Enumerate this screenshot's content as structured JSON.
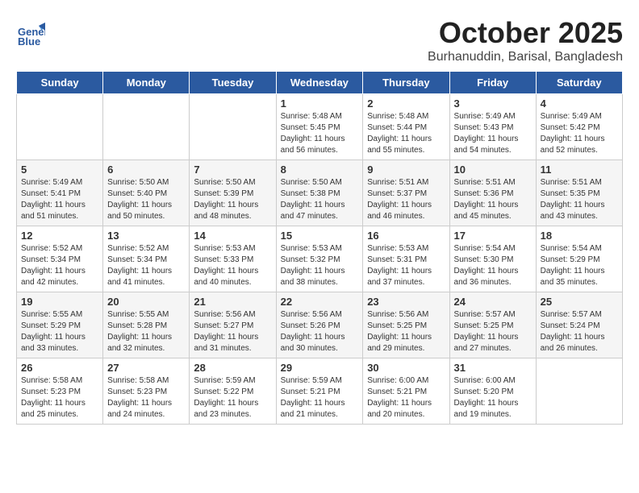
{
  "logo": {
    "name_line1": "General",
    "name_line2": "Blue"
  },
  "header": {
    "title": "October 2025",
    "subtitle": "Burhanuddin, Barisal, Bangladesh"
  },
  "weekdays": [
    "Sunday",
    "Monday",
    "Tuesday",
    "Wednesday",
    "Thursday",
    "Friday",
    "Saturday"
  ],
  "weeks": [
    [
      {
        "day": "",
        "sunrise": "",
        "sunset": "",
        "daylight": ""
      },
      {
        "day": "",
        "sunrise": "",
        "sunset": "",
        "daylight": ""
      },
      {
        "day": "",
        "sunrise": "",
        "sunset": "",
        "daylight": ""
      },
      {
        "day": "1",
        "sunrise": "Sunrise: 5:48 AM",
        "sunset": "Sunset: 5:45 PM",
        "daylight": "Daylight: 11 hours and 56 minutes."
      },
      {
        "day": "2",
        "sunrise": "Sunrise: 5:48 AM",
        "sunset": "Sunset: 5:44 PM",
        "daylight": "Daylight: 11 hours and 55 minutes."
      },
      {
        "day": "3",
        "sunrise": "Sunrise: 5:49 AM",
        "sunset": "Sunset: 5:43 PM",
        "daylight": "Daylight: 11 hours and 54 minutes."
      },
      {
        "day": "4",
        "sunrise": "Sunrise: 5:49 AM",
        "sunset": "Sunset: 5:42 PM",
        "daylight": "Daylight: 11 hours and 52 minutes."
      }
    ],
    [
      {
        "day": "5",
        "sunrise": "Sunrise: 5:49 AM",
        "sunset": "Sunset: 5:41 PM",
        "daylight": "Daylight: 11 hours and 51 minutes."
      },
      {
        "day": "6",
        "sunrise": "Sunrise: 5:50 AM",
        "sunset": "Sunset: 5:40 PM",
        "daylight": "Daylight: 11 hours and 50 minutes."
      },
      {
        "day": "7",
        "sunrise": "Sunrise: 5:50 AM",
        "sunset": "Sunset: 5:39 PM",
        "daylight": "Daylight: 11 hours and 48 minutes."
      },
      {
        "day": "8",
        "sunrise": "Sunrise: 5:50 AM",
        "sunset": "Sunset: 5:38 PM",
        "daylight": "Daylight: 11 hours and 47 minutes."
      },
      {
        "day": "9",
        "sunrise": "Sunrise: 5:51 AM",
        "sunset": "Sunset: 5:37 PM",
        "daylight": "Daylight: 11 hours and 46 minutes."
      },
      {
        "day": "10",
        "sunrise": "Sunrise: 5:51 AM",
        "sunset": "Sunset: 5:36 PM",
        "daylight": "Daylight: 11 hours and 45 minutes."
      },
      {
        "day": "11",
        "sunrise": "Sunrise: 5:51 AM",
        "sunset": "Sunset: 5:35 PM",
        "daylight": "Daylight: 11 hours and 43 minutes."
      }
    ],
    [
      {
        "day": "12",
        "sunrise": "Sunrise: 5:52 AM",
        "sunset": "Sunset: 5:34 PM",
        "daylight": "Daylight: 11 hours and 42 minutes."
      },
      {
        "day": "13",
        "sunrise": "Sunrise: 5:52 AM",
        "sunset": "Sunset: 5:34 PM",
        "daylight": "Daylight: 11 hours and 41 minutes."
      },
      {
        "day": "14",
        "sunrise": "Sunrise: 5:53 AM",
        "sunset": "Sunset: 5:33 PM",
        "daylight": "Daylight: 11 hours and 40 minutes."
      },
      {
        "day": "15",
        "sunrise": "Sunrise: 5:53 AM",
        "sunset": "Sunset: 5:32 PM",
        "daylight": "Daylight: 11 hours and 38 minutes."
      },
      {
        "day": "16",
        "sunrise": "Sunrise: 5:53 AM",
        "sunset": "Sunset: 5:31 PM",
        "daylight": "Daylight: 11 hours and 37 minutes."
      },
      {
        "day": "17",
        "sunrise": "Sunrise: 5:54 AM",
        "sunset": "Sunset: 5:30 PM",
        "daylight": "Daylight: 11 hours and 36 minutes."
      },
      {
        "day": "18",
        "sunrise": "Sunrise: 5:54 AM",
        "sunset": "Sunset: 5:29 PM",
        "daylight": "Daylight: 11 hours and 35 minutes."
      }
    ],
    [
      {
        "day": "19",
        "sunrise": "Sunrise: 5:55 AM",
        "sunset": "Sunset: 5:29 PM",
        "daylight": "Daylight: 11 hours and 33 minutes."
      },
      {
        "day": "20",
        "sunrise": "Sunrise: 5:55 AM",
        "sunset": "Sunset: 5:28 PM",
        "daylight": "Daylight: 11 hours and 32 minutes."
      },
      {
        "day": "21",
        "sunrise": "Sunrise: 5:56 AM",
        "sunset": "Sunset: 5:27 PM",
        "daylight": "Daylight: 11 hours and 31 minutes."
      },
      {
        "day": "22",
        "sunrise": "Sunrise: 5:56 AM",
        "sunset": "Sunset: 5:26 PM",
        "daylight": "Daylight: 11 hours and 30 minutes."
      },
      {
        "day": "23",
        "sunrise": "Sunrise: 5:56 AM",
        "sunset": "Sunset: 5:25 PM",
        "daylight": "Daylight: 11 hours and 29 minutes."
      },
      {
        "day": "24",
        "sunrise": "Sunrise: 5:57 AM",
        "sunset": "Sunset: 5:25 PM",
        "daylight": "Daylight: 11 hours and 27 minutes."
      },
      {
        "day": "25",
        "sunrise": "Sunrise: 5:57 AM",
        "sunset": "Sunset: 5:24 PM",
        "daylight": "Daylight: 11 hours and 26 minutes."
      }
    ],
    [
      {
        "day": "26",
        "sunrise": "Sunrise: 5:58 AM",
        "sunset": "Sunset: 5:23 PM",
        "daylight": "Daylight: 11 hours and 25 minutes."
      },
      {
        "day": "27",
        "sunrise": "Sunrise: 5:58 AM",
        "sunset": "Sunset: 5:23 PM",
        "daylight": "Daylight: 11 hours and 24 minutes."
      },
      {
        "day": "28",
        "sunrise": "Sunrise: 5:59 AM",
        "sunset": "Sunset: 5:22 PM",
        "daylight": "Daylight: 11 hours and 23 minutes."
      },
      {
        "day": "29",
        "sunrise": "Sunrise: 5:59 AM",
        "sunset": "Sunset: 5:21 PM",
        "daylight": "Daylight: 11 hours and 21 minutes."
      },
      {
        "day": "30",
        "sunrise": "Sunrise: 6:00 AM",
        "sunset": "Sunset: 5:21 PM",
        "daylight": "Daylight: 11 hours and 20 minutes."
      },
      {
        "day": "31",
        "sunrise": "Sunrise: 6:00 AM",
        "sunset": "Sunset: 5:20 PM",
        "daylight": "Daylight: 11 hours and 19 minutes."
      },
      {
        "day": "",
        "sunrise": "",
        "sunset": "",
        "daylight": ""
      }
    ]
  ]
}
